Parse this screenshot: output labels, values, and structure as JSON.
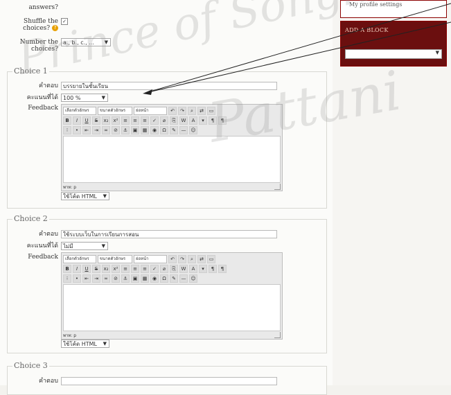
{
  "top": {
    "answers_label": "answers?",
    "shuffle_label_1": "Shuffle the",
    "shuffle_label_2": "choices?",
    "help_icon": "?",
    "shuffle_checked": "✓",
    "number_label_1": "Number the",
    "number_label_2": "choices?",
    "number_select": "a., b., c., ..."
  },
  "sidebar": {
    "profile_link": "My profile settings",
    "add_block_title": "ADD A BLOCK"
  },
  "watermark": {
    "line1": "Prince of Songkla",
    "line2": "Pattani"
  },
  "choices": [
    {
      "legend": "Choice 1",
      "answer_label": "คำตอบ",
      "answer_value": "บรรยายในชั้นเรียน",
      "grade_label": "คะแนนที่ได้",
      "grade_value": "100 %",
      "feedback_label": "Feedback",
      "path": "พาท: p",
      "format_value": "ใช้โค้ด HTML"
    },
    {
      "legend": "Choice 2",
      "answer_label": "คำตอบ",
      "answer_value": "ใช้ระบบเว็บในการเรียนการสอน",
      "grade_label": "คะแนนที่ได้",
      "grade_value": "ไม่มี",
      "feedback_label": "Feedback",
      "path": "พาท: p",
      "format_value": "ใช้โค้ด HTML"
    },
    {
      "legend": "Choice 3",
      "answer_label": "คำตอบ"
    }
  ],
  "editor": {
    "font_family": "เลือกตัวอักษร",
    "font_size": "ขนาดตัวอักษร",
    "heading": "ย่อหน้า"
  },
  "colors": {
    "sidebar_accent": "#8b0000"
  }
}
